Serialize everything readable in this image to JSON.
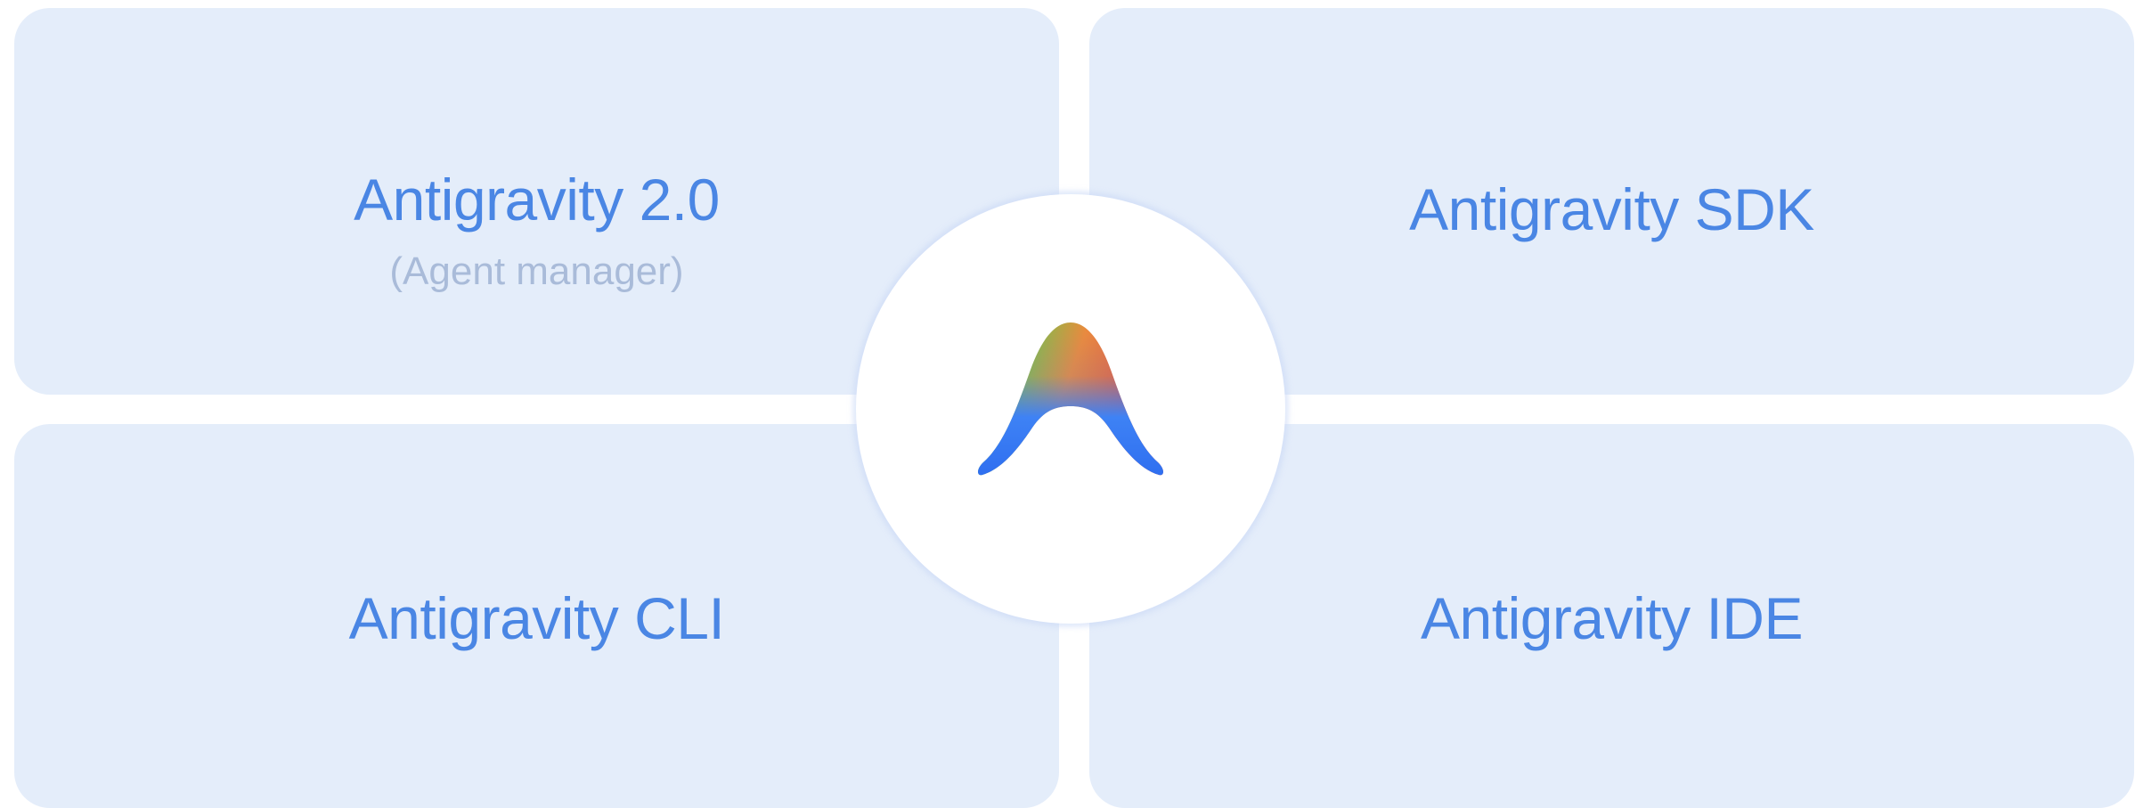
{
  "tiles": {
    "top_left": {
      "title": "Antigravity 2.0",
      "subtitle": "(Agent manager)"
    },
    "top_right": {
      "title": "Antigravity SDK"
    },
    "bottom_left": {
      "title": "Antigravity CLI"
    },
    "bottom_right": {
      "title": "Antigravity IDE"
    }
  },
  "hub": {
    "icon": "antigravity-logo-icon"
  },
  "colors": {
    "tile_bg": "#e4edfa",
    "title": "#4a86e4",
    "subtitle": "#a9bbd9",
    "hub_bg": "#ffffff"
  }
}
